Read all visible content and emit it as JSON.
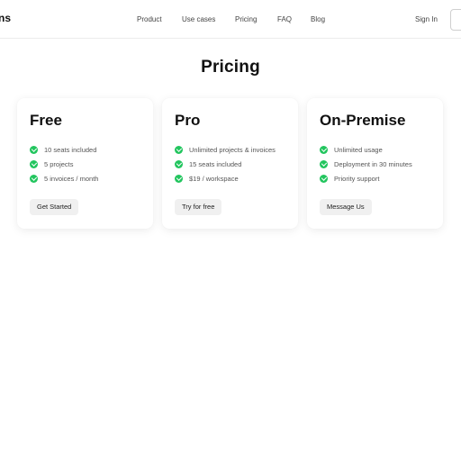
{
  "nav": {
    "logo_text": "ns",
    "links": [
      "Product",
      "Use cases",
      "Pricing",
      "FAQ",
      "Blog"
    ],
    "sign_in": "Sign In"
  },
  "page_title": "Pricing",
  "plans": [
    {
      "name": "Free",
      "features": [
        "10 seats included",
        "5 projects",
        "5 invoices / month"
      ],
      "button": "Get Started"
    },
    {
      "name": "Pro",
      "features": [
        "Unlimited projects & invoices",
        "15 seats included",
        "$19 / workspace"
      ],
      "button": "Try for free"
    },
    {
      "name": "On-Premise",
      "features": [
        "Unlimited usage",
        "Deployment in 30 minutes",
        "Priority support"
      ],
      "button": "Message Us"
    }
  ],
  "colors": {
    "check": "#22c55e",
    "button_bg": "#f0f0f0"
  },
  "icons": {
    "feature_bullet": "check-circle-icon"
  }
}
